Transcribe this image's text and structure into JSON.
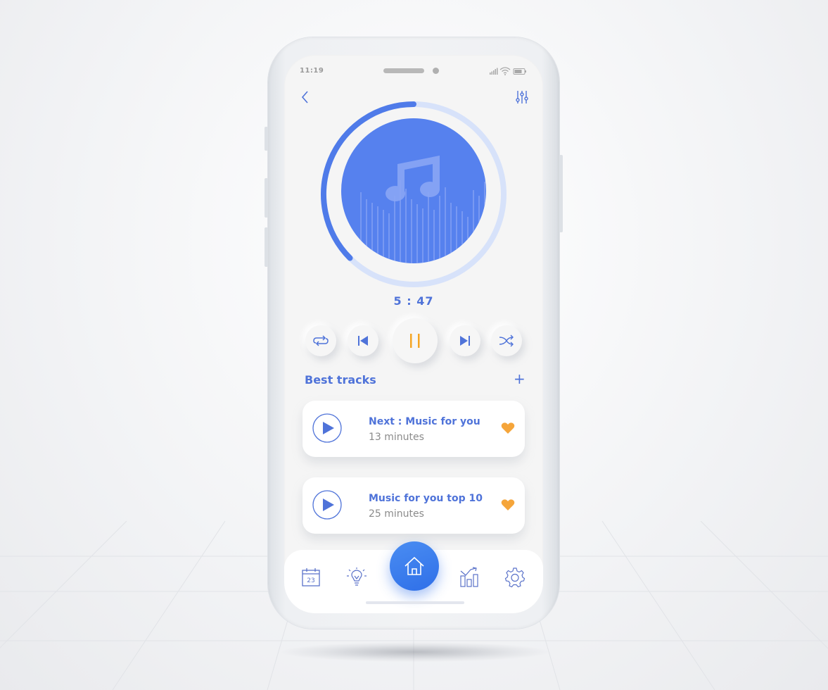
{
  "status_bar": {
    "time": "11:19"
  },
  "header": {
    "back_icon": "chevron-left-icon",
    "settings_icon": "equalizer-sliders-icon"
  },
  "player": {
    "artwork_icon": "music-note-icon",
    "progress_fraction": 0.375,
    "elapsed": "5 : 47",
    "colors": {
      "accent": "#4f7be9",
      "track": "#d5e1fb",
      "pause": "#f5a524"
    },
    "controls": [
      {
        "name": "repeat",
        "icon": "repeat-icon"
      },
      {
        "name": "previous",
        "icon": "skip-previous-icon"
      },
      {
        "name": "pause",
        "icon": "pause-icon"
      },
      {
        "name": "next",
        "icon": "skip-next-icon"
      },
      {
        "name": "shuffle",
        "icon": "shuffle-icon"
      }
    ]
  },
  "tracks": {
    "title": "Best tracks",
    "add_label": "+",
    "items": [
      {
        "title": "Next : Music for you",
        "duration": "13 minutes",
        "favorite": true
      },
      {
        "title": "Music for you top 10",
        "duration": "25 minutes",
        "favorite": true
      }
    ]
  },
  "nav": {
    "items": [
      {
        "name": "calendar",
        "icon": "calendar-icon",
        "label": "23"
      },
      {
        "name": "ideas",
        "icon": "lightbulb-icon"
      },
      {
        "name": "home",
        "icon": "home-icon",
        "active": true
      },
      {
        "name": "stats",
        "icon": "bar-chart-icon"
      },
      {
        "name": "settings",
        "icon": "gear-icon"
      }
    ]
  }
}
